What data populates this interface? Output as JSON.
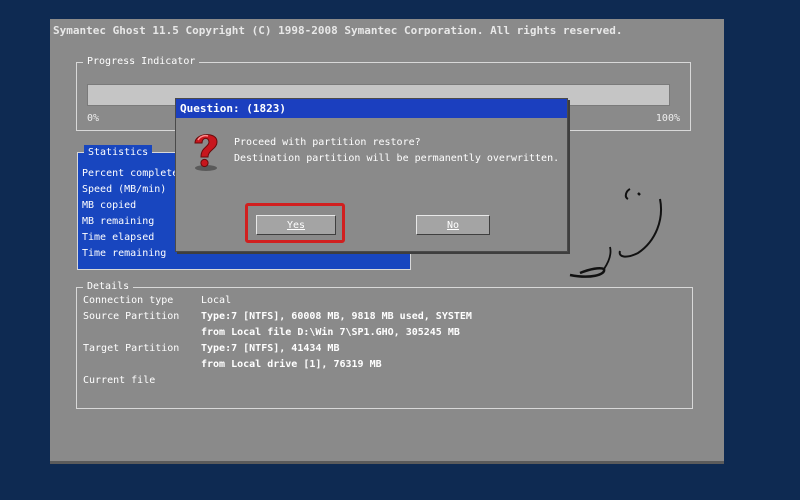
{
  "colors": {
    "desktop": "#0e2a52",
    "panel": "#8a8a8a",
    "accent_blue": "#1b3fbf",
    "highlight_red": "#d11f1f"
  },
  "app": {
    "title": "Symantec Ghost 11.5   Copyright (C) 1998-2008 Symantec Corporation. All rights reserved."
  },
  "progress": {
    "label": "Progress Indicator",
    "min_label": "0%",
    "max_label": "100%",
    "value": 0
  },
  "statistics": {
    "label": "Statistics",
    "items": [
      "Percent complete",
      "Speed (MB/min)",
      "MB copied",
      "MB remaining",
      "Time elapsed",
      "Time remaining"
    ]
  },
  "details": {
    "label": "Details",
    "rows": [
      {
        "label": "Connection type",
        "value": "Local"
      },
      {
        "label": "Source Partition",
        "value": "Type:7 [NTFS], 60008 MB, 9818 MB used, SYSTEM"
      },
      {
        "label": "",
        "value": "from Local file D:\\Win 7\\SP1.GHO, 305245 MB"
      },
      {
        "label": "Target Partition",
        "value": "Type:7 [NTFS], 41434 MB"
      },
      {
        "label": "",
        "value": "from Local drive [1], 76319 MB"
      },
      {
        "label": "Current file",
        "value": ""
      }
    ]
  },
  "dialog": {
    "title": "Question: (1823)",
    "icon": "question-icon",
    "lines": [
      "Proceed with partition restore?",
      "Destination partition will be permanently overwritten."
    ],
    "yes_label": "Yes",
    "no_label": "No"
  }
}
